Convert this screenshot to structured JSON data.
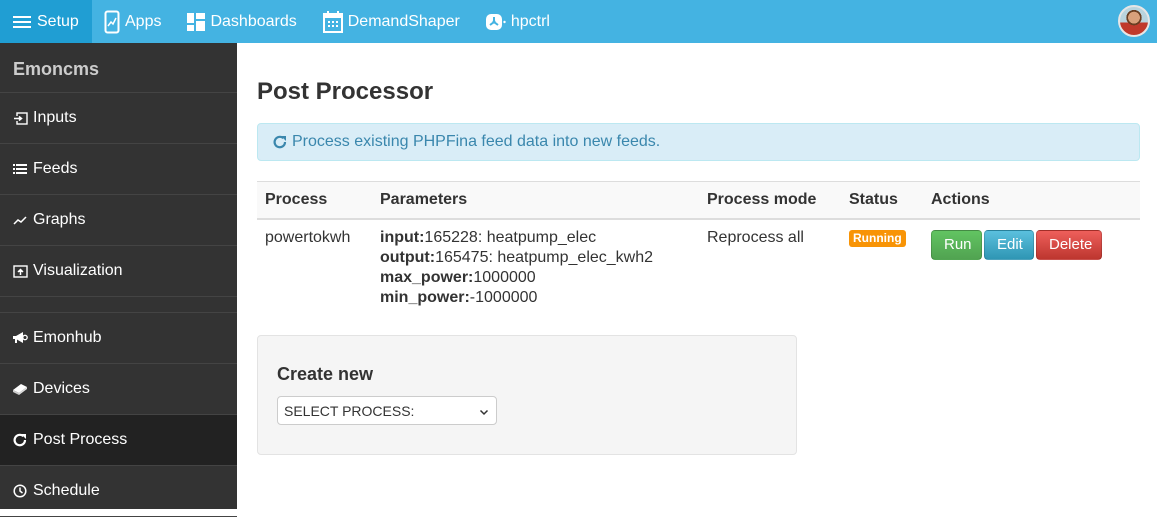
{
  "topnav": {
    "items": [
      {
        "label": "Setup",
        "icon": "menu-icon",
        "active": true
      },
      {
        "label": "Apps",
        "icon": "apps-icon"
      },
      {
        "label": "Dashboards",
        "icon": "dashboards-icon"
      },
      {
        "label": "DemandShaper",
        "icon": "calendar-icon"
      },
      {
        "label": "hpctrl",
        "icon": "hpctrl-icon"
      }
    ],
    "avatar": "user-avatar"
  },
  "sidebar": {
    "brand": "Emoncms",
    "items": [
      {
        "label": "Inputs",
        "icon": "input-icon"
      },
      {
        "label": "Feeds",
        "icon": "list-icon"
      },
      {
        "label": "Graphs",
        "icon": "graph-icon"
      },
      {
        "label": "Visualization",
        "icon": "upload-icon"
      },
      {
        "label": "Emonhub",
        "icon": "megaphone-icon"
      },
      {
        "label": "Devices",
        "icon": "device-icon"
      },
      {
        "label": "Post Process",
        "icon": "refresh-icon",
        "active": true
      },
      {
        "label": "Schedule",
        "icon": "clock-icon"
      }
    ]
  },
  "main": {
    "title": "Post Processor",
    "alert": "Process existing PHPFina feed data into new feeds.",
    "table": {
      "headers": [
        "Process",
        "Parameters",
        "Process mode",
        "Status",
        "Actions"
      ],
      "rows": [
        {
          "process": "powertokwh",
          "params": [
            {
              "key": "input:",
              "value": "165228: heatpump_elec"
            },
            {
              "key": "output:",
              "value": "165475: heatpump_elec_kwh2"
            },
            {
              "key": "max_power:",
              "value": "1000000"
            },
            {
              "key": "min_power:",
              "value": "-1000000"
            }
          ],
          "mode": "Reprocess all",
          "status": "Running",
          "actions": {
            "run": "Run",
            "edit": "Edit",
            "delete": "Delete"
          }
        }
      ]
    },
    "create": {
      "title": "Create new",
      "select_value": "SELECT PROCESS:"
    }
  },
  "colors": {
    "nav": "#44b3e2",
    "nav_active": "#209ed3",
    "sidebar": "#333333",
    "status_running": "#f89406",
    "btn_run": "#5bb75b",
    "btn_edit": "#49afcd",
    "btn_delete": "#da4f49"
  }
}
